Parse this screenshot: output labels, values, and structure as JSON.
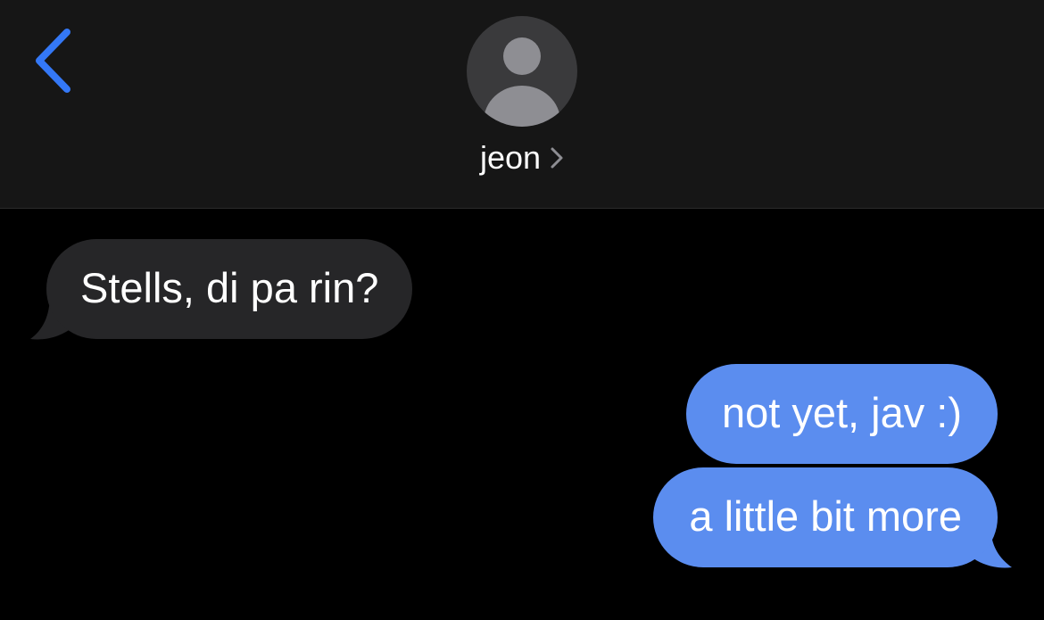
{
  "header": {
    "contact_name": "jeon",
    "back_icon": "chevron-left-icon",
    "chevron_icon": "chevron-right-icon",
    "avatar_icon": "person-silhouette-icon"
  },
  "messages": [
    {
      "direction": "incoming",
      "text": "Stells, di pa rin?"
    },
    {
      "direction": "outgoing",
      "text": "not yet, jav :)"
    },
    {
      "direction": "outgoing",
      "text": "a little bit more"
    }
  ],
  "colors": {
    "accent": "#3478f6",
    "header_bg": "#161616",
    "incoming_bubble": "#262628",
    "outgoing_bubble": "#5b8def",
    "background": "#000000"
  }
}
